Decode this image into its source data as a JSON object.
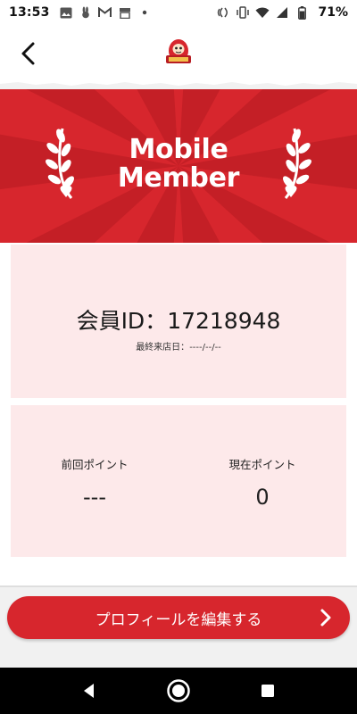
{
  "status_bar": {
    "time": "13:53",
    "battery": "71%",
    "left_icons": [
      "image-icon",
      "rabbit-app-icon",
      "gmail-icon",
      "store-icon",
      "dot-icon"
    ],
    "right_icons": [
      "nfc-icon",
      "vibrate-icon",
      "wifi-icon",
      "signal-icon",
      "battery-icon"
    ]
  },
  "header": {
    "back_icon": "chevron-left-icon",
    "logo_icon": "daruma-logo-icon"
  },
  "banner": {
    "title_line1": "Mobile",
    "title_line2": "Member",
    "background_color": "#d7262d"
  },
  "member": {
    "id_label": "会員ID：",
    "id_value": "17218948",
    "last_visit_label": "最終来店日：",
    "last_visit_value": "----/--/--"
  },
  "points": {
    "previous_label": "前回ポイント",
    "previous_value": "---",
    "current_label": "現在ポイント",
    "current_value": "0"
  },
  "actions": {
    "edit_profile_label": "プロフィールを編集する",
    "accent_color": "#d7262d"
  },
  "nav_bar": {
    "icons": [
      "nav-back-icon",
      "nav-home-icon",
      "nav-recents-icon"
    ]
  }
}
